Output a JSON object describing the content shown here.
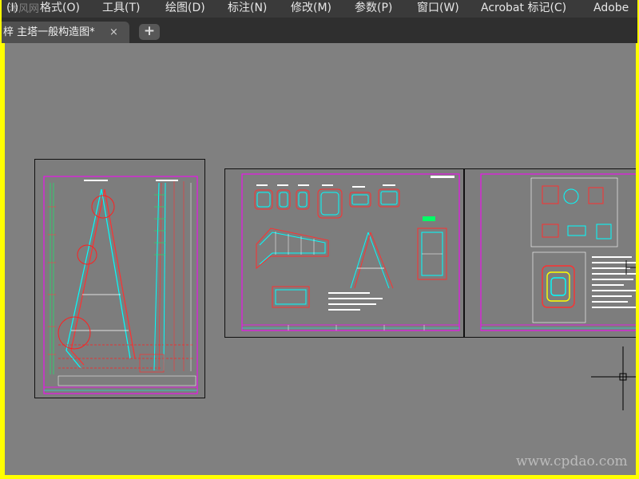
{
  "menu": {
    "items": [
      "(I)",
      "格式(O)",
      "工具(T)",
      "绘图(D)",
      "标注(N)",
      "修改(M)",
      "参数(P)",
      "窗口(W)",
      "Acrobat 标记(C)",
      "Adobe"
    ],
    "watermark": "沐风网"
  },
  "tabs": {
    "active_label": "梓 主塔一般构造图*",
    "close_glyph": "×",
    "add_glyph": "+"
  },
  "watermark": {
    "text": "www.cpdao.com"
  },
  "colors": {
    "workspace": "#808080",
    "menubar": "#3a3a3a",
    "frame": "#ffff00",
    "magenta": "#ff00ff",
    "cyan": "#00ffff",
    "red": "#ff2020"
  }
}
